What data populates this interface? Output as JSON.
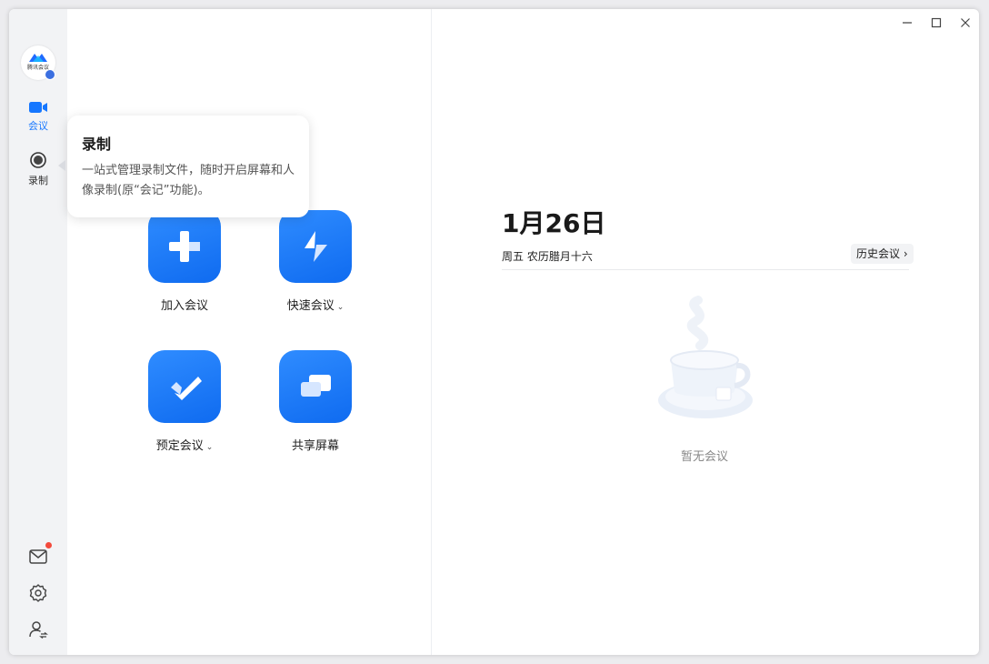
{
  "app": {
    "logo_text": "腾讯会议"
  },
  "sidebar": {
    "items": [
      {
        "label": "会议",
        "icon": "video-camera-icon",
        "active": true
      },
      {
        "label": "录制",
        "icon": "record-icon",
        "active": false
      }
    ],
    "bottom_icons": [
      "mail-icon",
      "gear-icon",
      "user-switch-icon"
    ]
  },
  "tooltip": {
    "title": "录制",
    "description": "一站式管理录制文件，随时开启屏幕和人像录制(原“会记”功能)。"
  },
  "actions": {
    "join": {
      "label": "加入会议",
      "icon": "plus-icon"
    },
    "quick": {
      "label": "快速会议",
      "icon": "lightning-icon"
    },
    "schedule": {
      "label": "预定会议",
      "icon": "check-icon"
    },
    "share": {
      "label": "共享屏幕",
      "icon": "screen-share-icon"
    }
  },
  "calendar": {
    "date": "1月26日",
    "weekday_lunar": "周五 农历腊月十六",
    "history_label": "历史会议",
    "empty_text": "暂无会议"
  },
  "colors": {
    "accent": "#1677ff",
    "badge": "#f34a3c"
  }
}
